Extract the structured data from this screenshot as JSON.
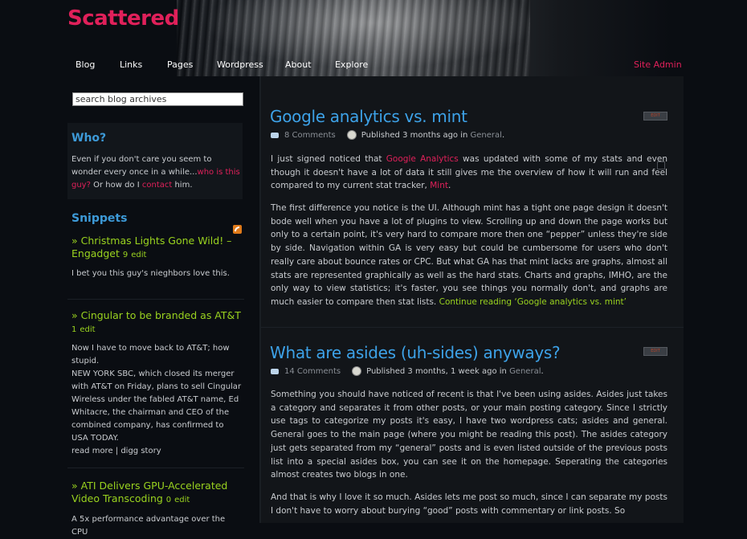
{
  "site": {
    "title": "Scattered",
    "nav": [
      "Blog",
      "Links",
      "Pages",
      "Wordpress",
      "About",
      "Explore"
    ],
    "admin": "Site Admin"
  },
  "sidebar": {
    "search_placeholder": "search blog archives",
    "who": {
      "heading": "Who?",
      "text_before": "Even if you don't care you seem to wonder every once in a while...",
      "link1": "who is this guy?",
      "text_mid": " Or how do I ",
      "link2": "contact",
      "text_after": " him."
    },
    "snippets": {
      "heading": "Snippets",
      "items": [
        {
          "title": "Christmas Lights Gone Wild! – Engadget",
          "count": "9",
          "edit": "edit",
          "body": "I bet you this guy's nieghbors love this."
        },
        {
          "title": "Cingular to be branded as AT&T",
          "count": "1",
          "edit": "edit",
          "body": "Now I have to move back to AT&T; how stupid.\nNEW YORK SBC, which closed its merger with AT&T on Friday, plans to sell Cingular Wireless under the fabled AT&T name, Ed Whitacre, the chairman and CEO of the combined company, has confirmed to USA TODAY.\nread more | digg story"
        },
        {
          "title": "ATI Delivers GPU-Accelerated Video Transcoding",
          "count": "0",
          "edit": "edit",
          "body": "A 5x performance advantage over the CPU"
        }
      ]
    }
  },
  "posts": [
    {
      "title": "Google analytics vs. mint",
      "edit": "EDIT",
      "comments": "8 Comments",
      "published": "Published 3 months ago in ",
      "category": "General",
      "p1_a": "I just signed noticed that ",
      "p1_link1": "Google Analytics",
      "p1_b": " was updated with some of my stats and even though it doesn't have a lot of data it still gives me the overview of how it will run and feel compared to my current stat tracker, ",
      "p1_link2": "Mint",
      "p1_c": ".",
      "p2": "The first difference you notice is the UI. Although mint has a tight one page design it doesn't bode well when you have a lot of plugins to view. Scrolling up and down the page works but only to a certain point, it's very hard to compare more then one “pepper” unless they're side by side. Navigation within GA is very easy but could be cumbersome for users who don't really care about bounce rates or CPC. But what GA has that mint lacks are graphs, almost all stats are represented graphically as well as the hard stats. Charts and graphs, IMHO, are the only way to view statistics; it's faster, you see things you normally don't, and graphs are much easier to compare then stat lists. ",
      "p2_link": "Continue reading ‘Google analytics vs. mint’"
    },
    {
      "title": "What are asides (uh-sides) anyways?",
      "edit": "EDIT",
      "comments": "14 Comments",
      "published": "Published 3 months, 1 week ago in ",
      "category": "General",
      "p1": "Something you should have noticed of recent is that I've been using asides. Asides just takes a category and separates it from other posts, or your main posting category. Since I strictly use tags to categorize my posts it's easy, I have two wordpress cats; asides and general. General goes to the main page (where you might be reading this post). The asides category just gets separated from my “general” posts and is even listed outside of the previous posts list into a special asides box, you can see it on the homepage. Seperating the categories almost creates two blogs in one.",
      "p2": "And that is why I love it so much. Asides lets me post so much, since I can separate my posts I don't have to worry about burying “good” posts with commentary or link posts. So"
    }
  ]
}
